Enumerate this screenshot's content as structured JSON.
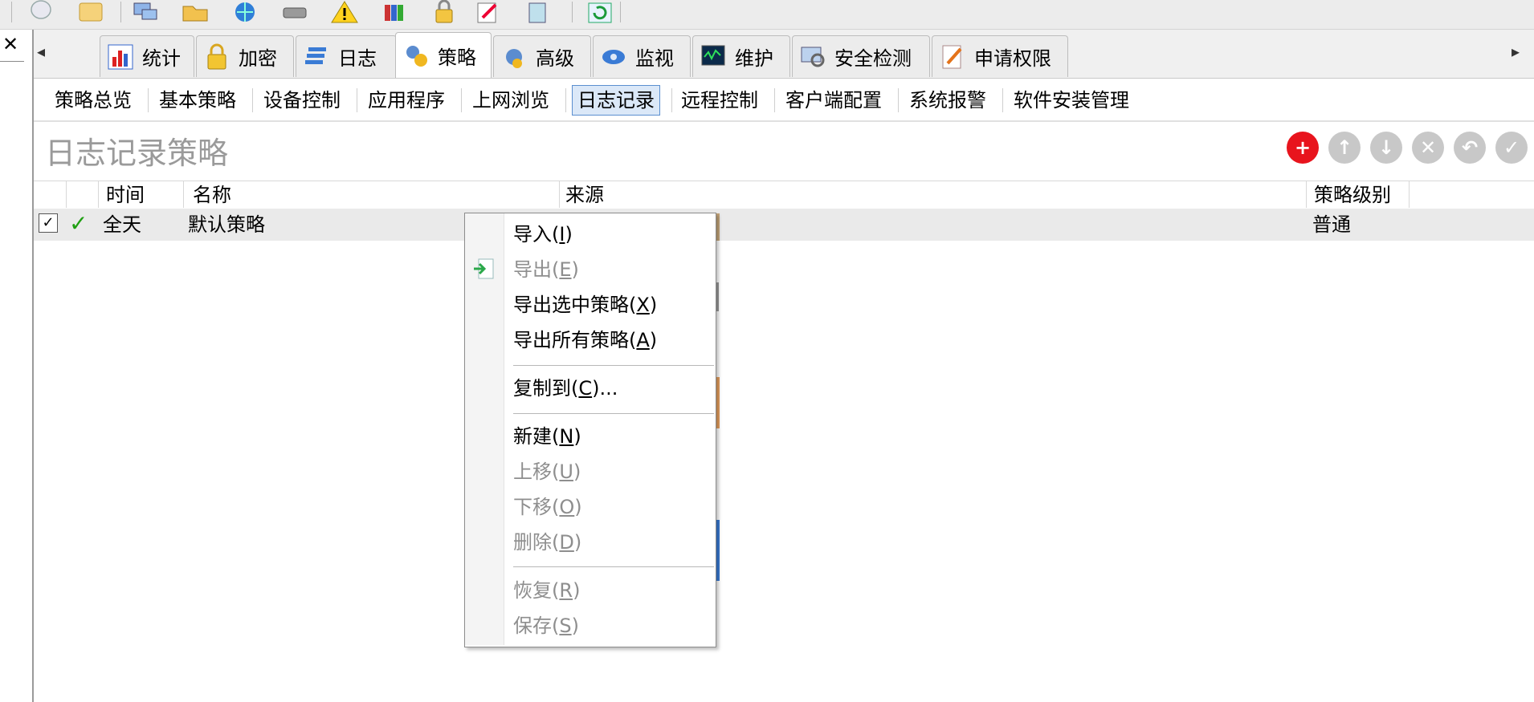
{
  "toolbar": {
    "icons": [
      "user-icon",
      "folder-icon",
      "computers-icon",
      "open-folder-icon",
      "globe-icon",
      "drive-icon",
      "warning-icon",
      "books-icon",
      "lock-icon",
      "edit-icon",
      "window-icon",
      "refresh-icon"
    ]
  },
  "left_pane": {
    "close_label": "✕"
  },
  "tabs": [
    {
      "label": "统计",
      "icon": "bar-chart-icon"
    },
    {
      "label": "加密",
      "icon": "padlock-icon"
    },
    {
      "label": "日志",
      "icon": "log-stack-icon"
    },
    {
      "label": "策略",
      "icon": "policy-gears-icon",
      "active": true
    },
    {
      "label": "高级",
      "icon": "advanced-gear-icon"
    },
    {
      "label": "监视",
      "icon": "monitor-eye-icon"
    },
    {
      "label": "维护",
      "icon": "maintenance-monitor-icon"
    },
    {
      "label": "安全检测",
      "icon": "security-scan-icon"
    },
    {
      "label": "申请权限",
      "icon": "request-permission-icon"
    }
  ],
  "subnav": [
    "策略总览",
    "基本策略",
    "设备控制",
    "应用程序",
    "上网浏览",
    "日志记录",
    "远程控制",
    "客户端配置",
    "系统报警",
    "软件安装管理"
  ],
  "subnav_active": "日志记录",
  "page": {
    "title": "日志记录策略"
  },
  "actions": [
    "add-icon",
    "up-arrow-icon",
    "down-arrow-icon",
    "delete-icon",
    "undo-icon",
    "save-check-icon"
  ],
  "table": {
    "columns": [
      "时间",
      "名称",
      "来源",
      "策略级别"
    ],
    "rows": [
      {
        "checked": true,
        "enabled": true,
        "time": "全天",
        "name": "默认策略",
        "source": "",
        "level": "普通"
      }
    ]
  },
  "context_menu": {
    "items": [
      {
        "text": "导入(",
        "key": "I",
        "close": ")",
        "enabled": true
      },
      {
        "text": "导出(",
        "key": "E",
        "close": ")",
        "enabled": false
      },
      {
        "text": "导出选中策略(",
        "key": "X",
        "close": ")",
        "enabled": true
      },
      {
        "text": "导出所有策略(",
        "key": "A",
        "close": ")",
        "enabled": true
      },
      {
        "text": "复制到(",
        "key": "C",
        "close": ")...",
        "enabled": true
      },
      {
        "text": "新建(",
        "key": "N",
        "close": ")",
        "enabled": true
      },
      {
        "text": "上移(",
        "key": "U",
        "close": ")",
        "enabled": false
      },
      {
        "text": "下移(",
        "key": "O",
        "close": ")",
        "enabled": false
      },
      {
        "text": "删除(",
        "key": "D",
        "close": ")",
        "enabled": false
      },
      {
        "text": "恢复(",
        "key": "R",
        "close": ")",
        "enabled": false
      },
      {
        "text": "保存(",
        "key": "S",
        "close": ")",
        "enabled": false
      }
    ]
  }
}
